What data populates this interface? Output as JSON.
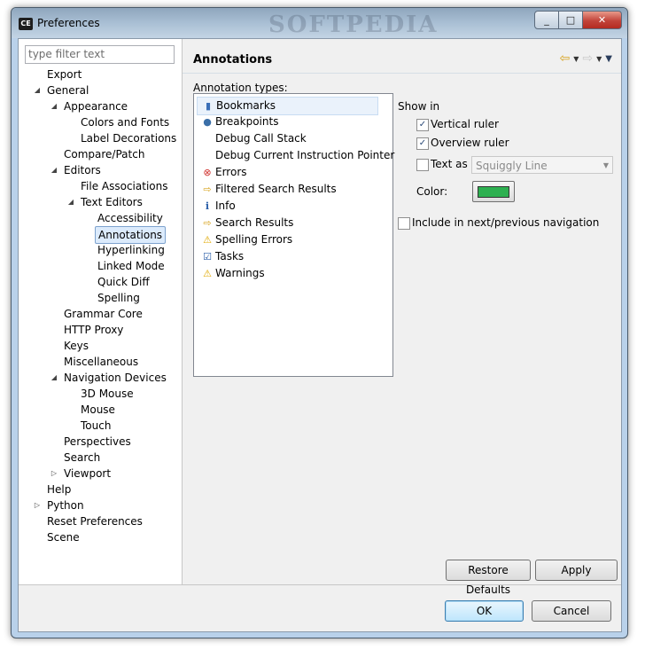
{
  "window": {
    "title": "Preferences",
    "app_icon_text": "CE",
    "watermark": "SOFTPEDIA",
    "minimize_glyph": "_",
    "maximize_glyph": "□",
    "close_glyph": "✕"
  },
  "filter": {
    "placeholder": "type filter text"
  },
  "tree": [
    {
      "label": "Export",
      "expander": ""
    },
    {
      "label": "General",
      "expander": "◢"
    },
    {
      "label": "Appearance",
      "expander": "◢"
    },
    {
      "label": "Colors and Fonts",
      "expander": ""
    },
    {
      "label": "Label Decorations",
      "expander": ""
    },
    {
      "label": "Compare/Patch",
      "expander": ""
    },
    {
      "label": "Editors",
      "expander": "◢"
    },
    {
      "label": "File Associations",
      "expander": ""
    },
    {
      "label": "Text Editors",
      "expander": "◢"
    },
    {
      "label": "Accessibility",
      "expander": ""
    },
    {
      "label": "Annotations",
      "expander": "",
      "selected": true
    },
    {
      "label": "Hyperlinking",
      "expander": ""
    },
    {
      "label": "Linked Mode",
      "expander": ""
    },
    {
      "label": "Quick Diff",
      "expander": ""
    },
    {
      "label": "Spelling",
      "expander": ""
    },
    {
      "label": "Grammar Core",
      "expander": ""
    },
    {
      "label": "HTTP Proxy",
      "expander": ""
    },
    {
      "label": "Keys",
      "expander": ""
    },
    {
      "label": "Miscellaneous",
      "expander": ""
    },
    {
      "label": "Navigation Devices",
      "expander": "◢"
    },
    {
      "label": "3D Mouse",
      "expander": ""
    },
    {
      "label": "Mouse",
      "expander": ""
    },
    {
      "label": "Touch",
      "expander": ""
    },
    {
      "label": "Perspectives",
      "expander": ""
    },
    {
      "label": "Search",
      "expander": ""
    },
    {
      "label": "Viewport",
      "expander": "▷"
    },
    {
      "label": "Help",
      "expander": ""
    },
    {
      "label": "Python",
      "expander": "▷"
    },
    {
      "label": "Reset Preferences",
      "expander": ""
    },
    {
      "label": "Scene",
      "expander": ""
    }
  ],
  "page": {
    "title": "Annotations",
    "annotation_types_label": "Annotation types:",
    "annotation_types": [
      {
        "label": "Bookmarks",
        "icon": "bookmark-icon",
        "glyph": "▮",
        "color": "#3a6fb8",
        "selected": true
      },
      {
        "label": "Breakpoints",
        "icon": "breakpoint-icon",
        "glyph": "●",
        "color": "#3b6fa8"
      },
      {
        "label": "Debug Call Stack",
        "icon": "",
        "glyph": "",
        "color": "#000000"
      },
      {
        "label": "Debug Current Instruction Pointer",
        "icon": "",
        "glyph": "",
        "color": "#000000"
      },
      {
        "label": "Errors",
        "icon": "error-icon",
        "glyph": "⊗",
        "color": "#d0312d"
      },
      {
        "label": "Filtered Search Results",
        "icon": "search-result-arrow-icon",
        "glyph": "⇨",
        "color": "#d7a21c"
      },
      {
        "label": "Info",
        "icon": "info-icon",
        "glyph": "i",
        "color": "#2a5ea8"
      },
      {
        "label": "Search Results",
        "icon": "search-result-arrow-icon",
        "glyph": "⇨",
        "color": "#d7a21c"
      },
      {
        "label": "Spelling Errors",
        "icon": "warning-icon",
        "glyph": "⚠",
        "color": "#e0a800"
      },
      {
        "label": "Tasks",
        "icon": "task-icon",
        "glyph": "☑",
        "color": "#2a5ea8"
      },
      {
        "label": "Warnings",
        "icon": "warning-icon",
        "glyph": "⚠",
        "color": "#e0a800"
      }
    ],
    "show_in_label": "Show in",
    "vertical_ruler": {
      "label": "Vertical ruler",
      "checked": true
    },
    "overview_ruler": {
      "label": "Overview ruler",
      "checked": true
    },
    "text_as": {
      "label": "Text as",
      "checked": false,
      "value": "Squiggly Line"
    },
    "color_label": "Color:",
    "color_value": "#2db050",
    "include_navigation": {
      "label": "Include in next/previous navigation",
      "checked": false
    },
    "restore_defaults": "Restore Defaults",
    "apply": "Apply"
  },
  "footer": {
    "ok": "OK",
    "cancel": "Cancel"
  }
}
